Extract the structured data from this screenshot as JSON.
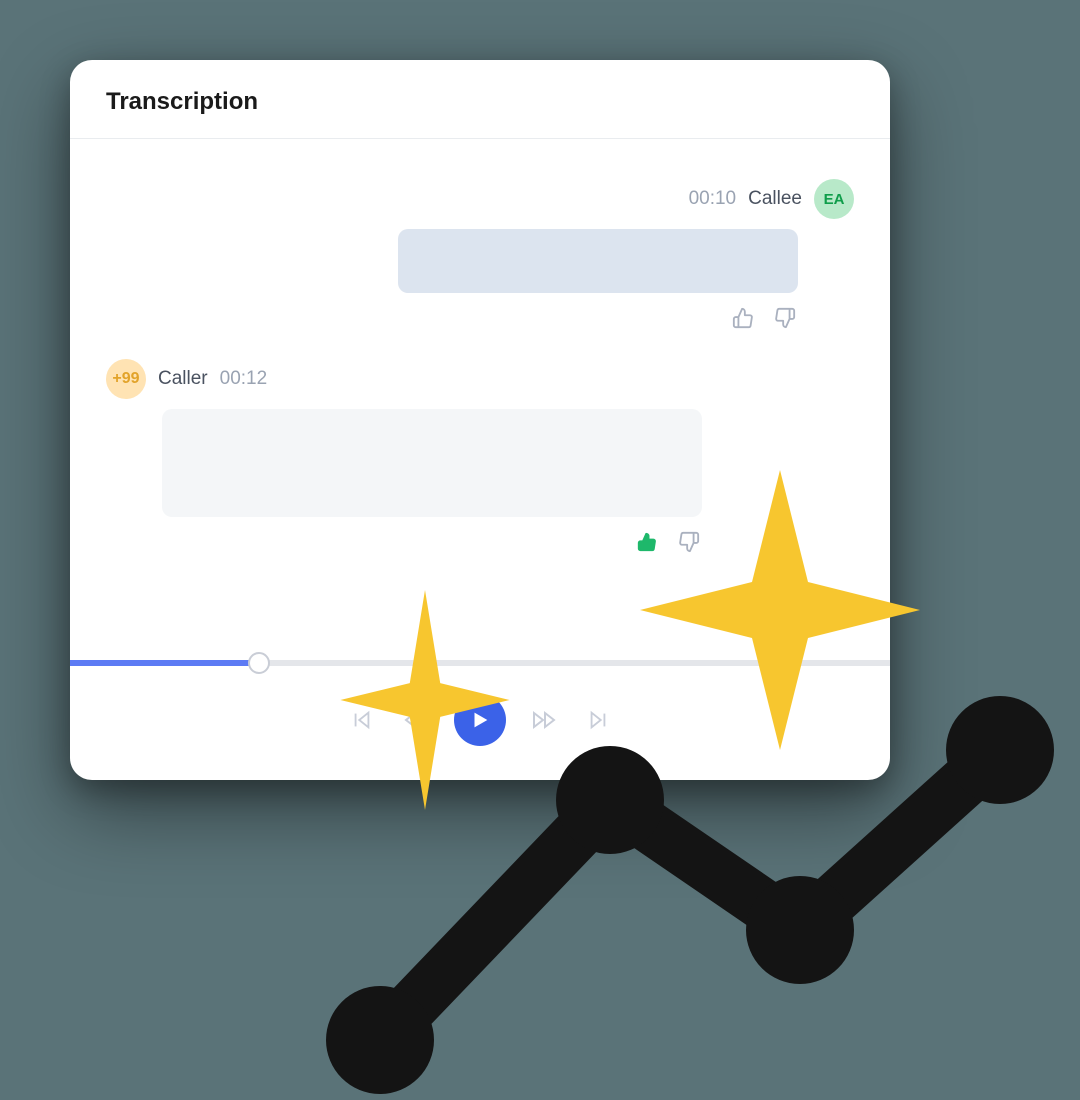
{
  "card": {
    "title": "Transcription"
  },
  "messages": {
    "callee": {
      "name": "Callee",
      "time": "00:10",
      "avatar": "EA"
    },
    "caller": {
      "name": "Caller",
      "time": "00:12",
      "avatar": "+99"
    }
  },
  "player": {
    "progress_percent": 23
  },
  "colors": {
    "accent": "#3b62e8",
    "sparkle": "#f7c62f"
  }
}
